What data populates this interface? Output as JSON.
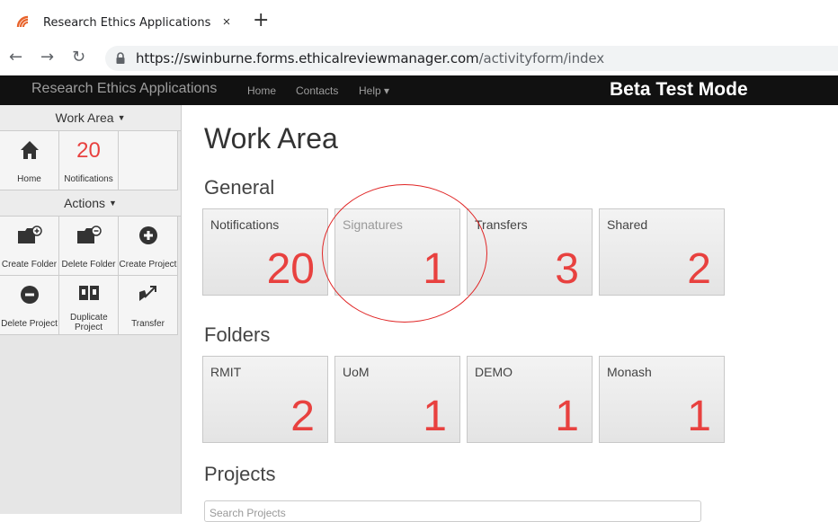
{
  "browser": {
    "tab_title": "Research Ethics Applications",
    "tab_close": "×",
    "new_tab": "+",
    "url_main": "https://swinburne.forms.ethicalreviewmanager.com",
    "url_path": "/activityform/index",
    "icons": [
      "wifi-logo-icon",
      "close-icon",
      "plus-icon",
      "back-icon",
      "forward-icon",
      "reload-icon",
      "lock-icon"
    ]
  },
  "navbar": {
    "brand": "Research Ethics Applications",
    "links": [
      "Home",
      "Contacts",
      "Help ▾"
    ],
    "beta": "Beta Test Mode"
  },
  "sidebar": {
    "work_area": "Work Area",
    "home_label": "Home",
    "notif_count": "20",
    "notif_label": "Notifications",
    "actions": "Actions",
    "create_folder": "Create Folder",
    "delete_folder": "Delete Folder",
    "create_project": "Create Project",
    "delete_project": "Delete Project",
    "duplicate_project": "Duplicate Project",
    "transfer": "Transfer"
  },
  "main": {
    "title": "Work Area",
    "general": "General",
    "general_cards": [
      {
        "label": "Notifications",
        "count": "20"
      },
      {
        "label": "Signatures",
        "count": "1"
      },
      {
        "label": "Transfers",
        "count": "3"
      },
      {
        "label": "Shared",
        "count": "2"
      }
    ],
    "folders": "Folders",
    "folder_cards": [
      {
        "label": "RMIT",
        "count": "2"
      },
      {
        "label": "UoM",
        "count": "1"
      },
      {
        "label": "DEMO",
        "count": "1"
      },
      {
        "label": "Monash",
        "count": "1"
      }
    ],
    "projects": "Projects",
    "search_placeholder": "Search Projects"
  },
  "colors": {
    "accent": "#e8413f",
    "navbar": "#111111",
    "annotation": "#e02424"
  }
}
